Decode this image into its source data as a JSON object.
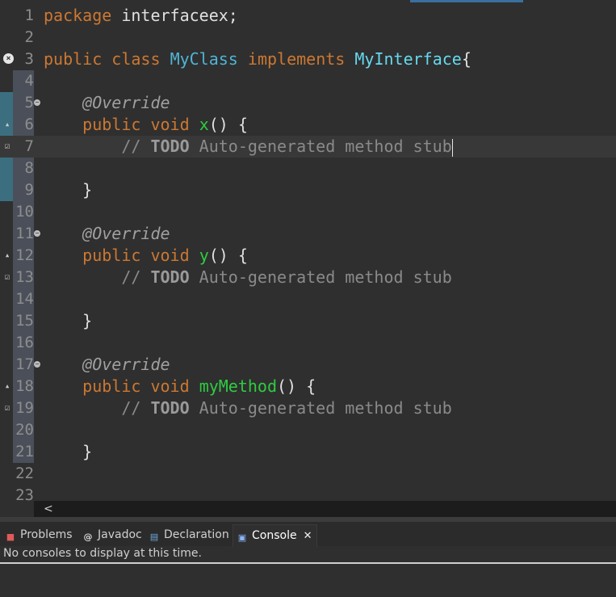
{
  "editor": {
    "lines": [
      {
        "n": "1",
        "tokens": [
          [
            "kw",
            "package"
          ],
          [
            "plain",
            " interfaceex;"
          ]
        ]
      },
      {
        "n": "2",
        "tokens": []
      },
      {
        "n": "3",
        "tokens": [
          [
            "kw",
            "public"
          ],
          [
            "plain",
            " "
          ],
          [
            "kw",
            "class"
          ],
          [
            "plain",
            " "
          ],
          [
            "type",
            "MyClass"
          ],
          [
            "plain",
            " "
          ],
          [
            "kw",
            "implements"
          ],
          [
            "plain",
            " "
          ],
          [
            "iface",
            "MyInterface"
          ],
          [
            "plain",
            "{"
          ]
        ]
      },
      {
        "n": "4",
        "tokens": []
      },
      {
        "n": "5",
        "tokens": [
          [
            "plain",
            "    "
          ],
          [
            "ann",
            "@Override"
          ]
        ]
      },
      {
        "n": "6",
        "tokens": [
          [
            "plain",
            "    "
          ],
          [
            "kw",
            "public"
          ],
          [
            "plain",
            " "
          ],
          [
            "kw",
            "void"
          ],
          [
            "plain",
            " "
          ],
          [
            "meth",
            "x"
          ],
          [
            "plain",
            "() {"
          ]
        ]
      },
      {
        "n": "7",
        "tokens": [
          [
            "plain",
            "        "
          ],
          [
            "cmt",
            "// "
          ],
          [
            "todo",
            "TODO"
          ],
          [
            "cmt",
            " Auto-generated method stub"
          ]
        ]
      },
      {
        "n": "8",
        "tokens": []
      },
      {
        "n": "9",
        "tokens": [
          [
            "plain",
            "    }"
          ]
        ]
      },
      {
        "n": "10",
        "tokens": []
      },
      {
        "n": "11",
        "tokens": [
          [
            "plain",
            "    "
          ],
          [
            "ann",
            "@Override"
          ]
        ]
      },
      {
        "n": "12",
        "tokens": [
          [
            "plain",
            "    "
          ],
          [
            "kw",
            "public"
          ],
          [
            "plain",
            " "
          ],
          [
            "kw",
            "void"
          ],
          [
            "plain",
            " "
          ],
          [
            "meth",
            "y"
          ],
          [
            "plain",
            "() {"
          ]
        ]
      },
      {
        "n": "13",
        "tokens": [
          [
            "plain",
            "        "
          ],
          [
            "cmt",
            "// "
          ],
          [
            "todo",
            "TODO"
          ],
          [
            "cmt",
            " Auto-generated method stub"
          ]
        ]
      },
      {
        "n": "14",
        "tokens": []
      },
      {
        "n": "15",
        "tokens": [
          [
            "plain",
            "    }"
          ]
        ]
      },
      {
        "n": "16",
        "tokens": []
      },
      {
        "n": "17",
        "tokens": [
          [
            "plain",
            "    "
          ],
          [
            "ann",
            "@Override"
          ]
        ]
      },
      {
        "n": "18",
        "tokens": [
          [
            "plain",
            "    "
          ],
          [
            "kw",
            "public"
          ],
          [
            "plain",
            " "
          ],
          [
            "kw",
            "void"
          ],
          [
            "plain",
            " "
          ],
          [
            "meth",
            "myMethod"
          ],
          [
            "plain",
            "() {"
          ]
        ]
      },
      {
        "n": "19",
        "tokens": [
          [
            "plain",
            "        "
          ],
          [
            "cmt",
            "// "
          ],
          [
            "todo",
            "TODO"
          ],
          [
            "cmt",
            " Auto-generated method stub"
          ]
        ]
      },
      {
        "n": "20",
        "tokens": []
      },
      {
        "n": "21",
        "tokens": [
          [
            "plain",
            "    }"
          ]
        ]
      },
      {
        "n": "22",
        "tokens": []
      },
      {
        "n": "23",
        "tokens": []
      }
    ],
    "current_line": "7",
    "markers": {
      "3": "error-icon",
      "6": "override-icon",
      "7": "task-icon",
      "12": "override-icon",
      "13": "task-icon",
      "18": "override-icon",
      "19": "task-icon"
    },
    "fold_lines": [
      "5",
      "11",
      "17"
    ],
    "scroll_left_arrow": "<"
  },
  "panel": {
    "tabs": [
      {
        "label": "Problems",
        "icon": "problems-icon"
      },
      {
        "label": "Javadoc",
        "icon": "javadoc-icon"
      },
      {
        "label": "Declaration",
        "icon": "declaration-icon"
      },
      {
        "label": "Console",
        "icon": "console-icon",
        "active": true
      }
    ],
    "close_glyph": "✕",
    "message": "No consoles to display at this time."
  },
  "colors": {
    "background": "#2f2f2f",
    "keyword": "#cc7832",
    "type": "#4fb5d6",
    "method": "#2ecc40",
    "annotation": "#a0a0a0",
    "comment": "#8a8a8a"
  }
}
